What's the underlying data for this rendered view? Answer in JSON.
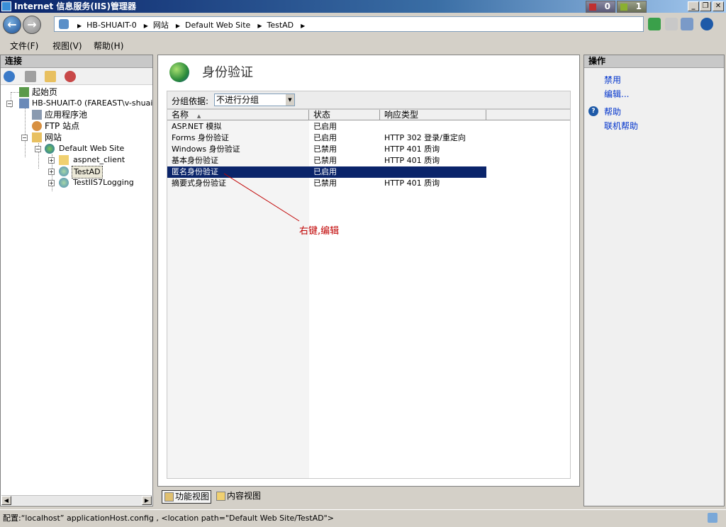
{
  "window": {
    "title": "Internet 信息服务(IIS)管理器",
    "counter_red": "0",
    "counter_green": "1",
    "minimize_label": "_",
    "maximize_label": "❐",
    "close_label": "✕"
  },
  "nav": {
    "back_label": "←",
    "forward_label": "→",
    "breadcrumbs": [
      "HB-SHUAIT-0",
      "网站",
      "Default Web Site",
      "TestAD"
    ]
  },
  "menu": {
    "file": "文件(F)",
    "view": "视图(V)",
    "help": "帮助(H)"
  },
  "connections": {
    "title": "连接",
    "tree": {
      "start_page": "起始页",
      "server": "HB-SHUAIT-0 (FAREAST\\v-shuai",
      "app_pools": "应用程序池",
      "ftp_sites": "FTP 站点",
      "sites": "网站",
      "default_web_site": "Default Web Site",
      "aspnet_client": "aspnet_client",
      "testad": "TestAD",
      "testiis7logging": "TestIIS7Logging"
    }
  },
  "main": {
    "title": "身份验证",
    "group_by_label": "分组依据:",
    "group_by_value": "不进行分组",
    "columns": {
      "name": "名称",
      "status": "状态",
      "response_type": "响应类型"
    },
    "rows": [
      {
        "name": "ASP.NET 模拟",
        "status": "已启用",
        "response": ""
      },
      {
        "name": "Forms 身份验证",
        "status": "已启用",
        "response": "HTTP 302 登录/重定向"
      },
      {
        "name": "Windows 身份验证",
        "status": "已禁用",
        "response": "HTTP 401 质询"
      },
      {
        "name": "基本身份验证",
        "status": "已禁用",
        "response": "HTTP 401 质询"
      },
      {
        "name": "匿名身份验证",
        "status": "已启用",
        "response": ""
      },
      {
        "name": "摘要式身份验证",
        "status": "已禁用",
        "response": "HTTP 401 质询"
      }
    ],
    "annotation": "右键,编辑",
    "views": {
      "features": "功能视图",
      "content": "内容视图"
    }
  },
  "actions": {
    "title": "操作",
    "disable": "禁用",
    "edit": "编辑...",
    "help": "帮助",
    "online_help": "联机帮助",
    "help_icon_glyph": "?"
  },
  "status": {
    "text": "配置:“localhost” applicationHost.config , <location path=\"Default Web Site/TestAD\">"
  },
  "colors": {
    "selection": "#0a246a",
    "link": "#0033cc",
    "annotation": "#c00000"
  }
}
